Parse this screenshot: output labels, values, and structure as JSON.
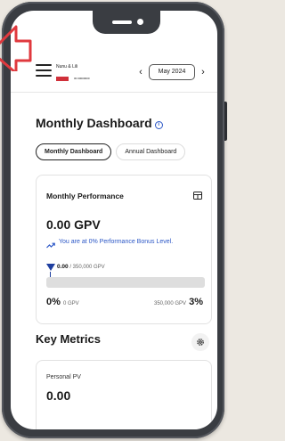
{
  "header": {
    "account_name": "Nunu & Lili",
    "account_id": "00 00000000",
    "month": "May 2024",
    "prev_label": "‹",
    "next_label": "›"
  },
  "page": {
    "title": "Monthly Dashboard",
    "tabs": [
      {
        "label": "Monthly Dashboard",
        "active": true
      },
      {
        "label": "Annual Dashboard",
        "active": false
      }
    ]
  },
  "performance": {
    "title": "Monthly Performance",
    "gpv": "0.00 GPV",
    "bonus_text": "You are at 0% Performance Bonus Level.",
    "progress_current": "0.00",
    "progress_target": "/ 350,000 GPV",
    "progress_fraction": 0.0,
    "scale_left_pct": "0%",
    "scale_left_unit": "0 GPV",
    "scale_right_unit": "350,000 GPV",
    "scale_right_pct": "3%"
  },
  "key_metrics": {
    "title": "Key Metrics",
    "metrics": [
      {
        "label": "Personal PV",
        "value": "0.00"
      }
    ]
  },
  "colors": {
    "accent_blue": "#2a56c6",
    "progress_blue": "#1f3fa0",
    "arrow_red": "#e0393e"
  },
  "icons": [
    "hamburger-icon",
    "chevron-left-icon",
    "chevron-right-icon",
    "info-icon",
    "table-icon",
    "trend-icon",
    "gear-icon",
    "pointer-arrow-icon"
  ]
}
